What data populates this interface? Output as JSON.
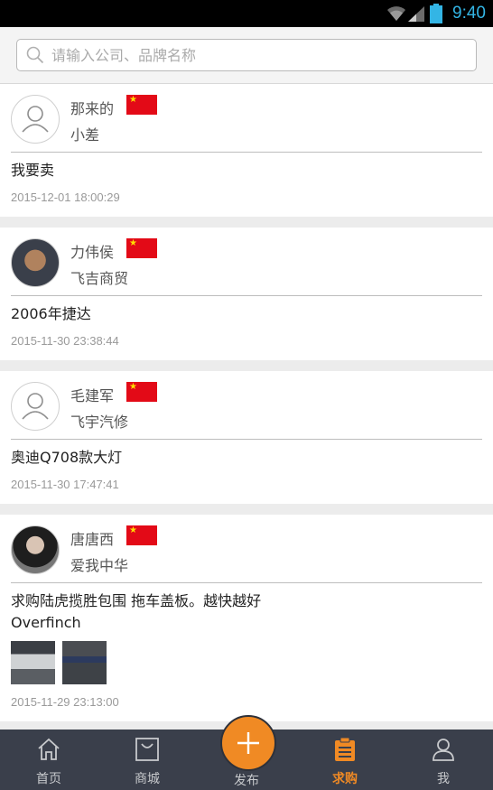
{
  "status_bar": {
    "time": "9:40"
  },
  "search": {
    "placeholder": "请输入公司、品牌名称"
  },
  "posts": [
    {
      "name": "那来的",
      "company": "小差",
      "message": "我要卖",
      "timestamp": "2015-12-01 18:00:29",
      "avatar": "default-avatar-icon"
    },
    {
      "name": "力伟侯",
      "company": "飞吉商贸",
      "message": "2006年捷达",
      "timestamp": "2015-11-30 23:38:44",
      "avatar": "photo"
    },
    {
      "name": "毛建军",
      "company": "飞宇汽修",
      "message": "奥迪Q708款大灯",
      "timestamp": "2015-11-30 17:47:41",
      "avatar": "default-avatar-icon"
    },
    {
      "name": "唐唐西",
      "company": "爱我中华",
      "message": "求购陆虎揽胜包围 拖车盖板。越快越好",
      "message_line2": "Overfinch",
      "timestamp": "2015-11-29 23:13:00",
      "avatar": "photo",
      "image_count": 2
    }
  ],
  "nav": {
    "home": "首页",
    "mall": "商城",
    "publish": "发布",
    "purchase": "求购",
    "me": "我"
  },
  "colors": {
    "accent": "#f08a24",
    "nav_bg": "#3a3f4b",
    "flag_red": "#e30a17",
    "flag_star": "#ffde00",
    "status_blue": "#33b5e5"
  }
}
